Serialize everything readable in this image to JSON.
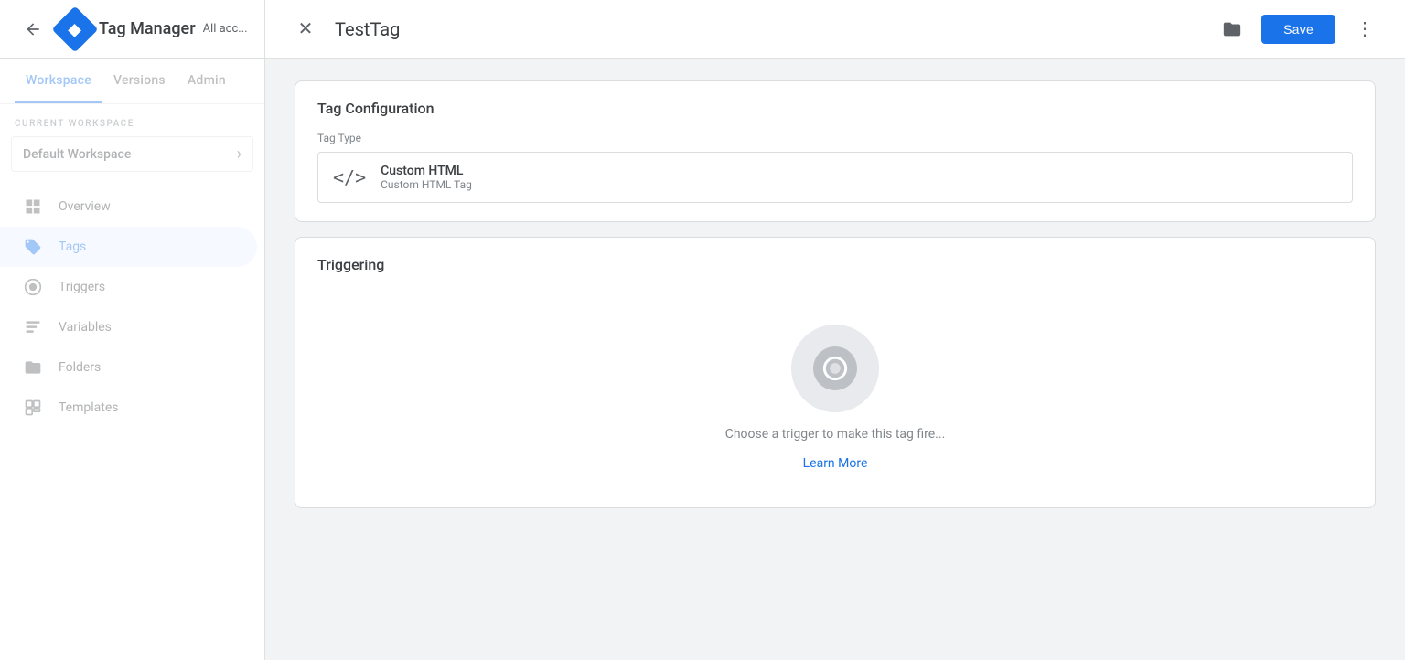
{
  "app": {
    "title": "Tag Manager",
    "account_label": "All acc...",
    "account_url": "www..."
  },
  "nav_tabs": {
    "workspace": "Workspace",
    "versions": "Versions",
    "admin": "Admin",
    "active": "workspace"
  },
  "workspace": {
    "label": "CURRENT WORKSPACE",
    "name": "Default Workspace"
  },
  "sidebar_nav": [
    {
      "id": "overview",
      "label": "Overview",
      "icon": "grid"
    },
    {
      "id": "tags",
      "label": "Tags",
      "icon": "tag",
      "active": true
    },
    {
      "id": "triggers",
      "label": "Triggers",
      "icon": "circle"
    },
    {
      "id": "variables",
      "label": "Variables",
      "icon": "calendar"
    },
    {
      "id": "folders",
      "label": "Folders",
      "icon": "folder"
    },
    {
      "id": "templates",
      "label": "Templates",
      "icon": "template"
    }
  ],
  "panel": {
    "title": "TestTag",
    "save_label": "Save",
    "more_label": "More options"
  },
  "tag_config": {
    "section_title": "Tag Configuration",
    "tag_type_label": "Tag Type",
    "type_name": "Custom HTML",
    "type_description": "Custom HTML Tag"
  },
  "triggering": {
    "section_title": "Triggering",
    "empty_text": "Choose a trigger to make this tag fire...",
    "learn_more": "Learn More"
  }
}
